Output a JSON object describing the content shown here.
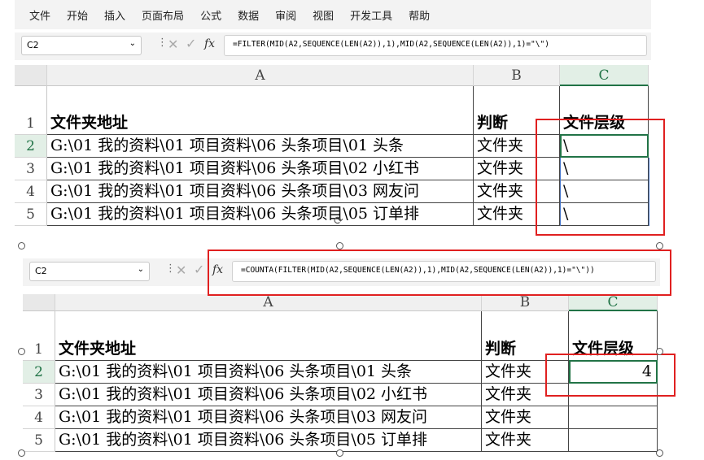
{
  "menu": [
    "文件",
    "开始",
    "插入",
    "页面布局",
    "公式",
    "数据",
    "审阅",
    "视图",
    "开发工具",
    "帮助"
  ],
  "top": {
    "name_box": "C2",
    "formula": "=FILTER(MID(A2,SEQUENCE(LEN(A2)),1),MID(A2,SEQUENCE(LEN(A2)),1)=\"\\\")",
    "columns": [
      "A",
      "B",
      "C"
    ],
    "rows": [
      "1",
      "2",
      "3",
      "4",
      "5"
    ],
    "header": [
      "文件夹地址",
      "判断",
      "文件层级"
    ],
    "data": [
      [
        "G:\\01 我的资料\\01 项目资料\\06 头条项目\\01 头条",
        "文件夹",
        "\\"
      ],
      [
        "G:\\01 我的资料\\01 项目资料\\06 头条项目\\02 小红书",
        "文件夹",
        "\\"
      ],
      [
        "G:\\01 我的资料\\01 项目资料\\06 头条项目\\03 网友问",
        "文件夹",
        "\\"
      ],
      [
        "G:\\01 我的资料\\01 项目资料\\06 头条项目\\05 订单排",
        "文件夹",
        "\\"
      ]
    ]
  },
  "bottom": {
    "name_box": "C2",
    "formula": "=COUNTA(FILTER(MID(A2,SEQUENCE(LEN(A2)),1),MID(A2,SEQUENCE(LEN(A2)),1)=\"\\\"))",
    "columns": [
      "A",
      "B",
      "C"
    ],
    "rows": [
      "1",
      "2",
      "3",
      "4",
      "5"
    ],
    "header": [
      "文件夹地址",
      "判断",
      "文件层级"
    ],
    "data": [
      [
        "G:\\01 我的资料\\01 项目资料\\06 头条项目\\01 头条",
        "文件夹",
        "4"
      ],
      [
        "G:\\01 我的资料\\01 项目资料\\06 头条项目\\02 小红书",
        "文件夹",
        ""
      ],
      [
        "G:\\01 我的资料\\01 项目资料\\06 头条项目\\03 网友问",
        "文件夹",
        ""
      ],
      [
        "G:\\01 我的资料\\01 项目资料\\06 头条项目\\05 订单排",
        "文件夹",
        ""
      ]
    ]
  },
  "accent": "#217346",
  "highlight": "#e02020"
}
